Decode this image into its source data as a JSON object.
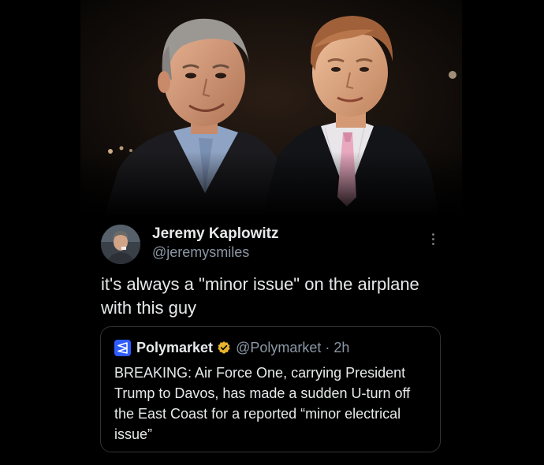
{
  "colors": {
    "background": "#000000",
    "text_primary": "#e7e9ea",
    "text_secondary": "#8b98a5",
    "card_border": "#2f3336",
    "polymarket_brand": "#2e5cff",
    "verified_gold": "#e8b32c"
  },
  "photo": {
    "icon": "photo-image"
  },
  "tweet": {
    "author": {
      "display_name": "Jeremy Kaplowitz",
      "handle": "@jeremysmiles",
      "avatar_icon": "user-avatar"
    },
    "more_icon": "more-options-icon",
    "text": "it's always a \"minor issue\" on the airplane with this guy"
  },
  "quoted_tweet": {
    "logo_icon": "polymarket-logo-icon",
    "display_name": "Polymarket",
    "verified_icon": "verified-gold-badge-icon",
    "handle": "@Polymarket",
    "separator": "·",
    "time": "2h",
    "text": "BREAKING: Air Force One, carrying President Trump to Davos, has made a sudden U-turn off the East Coast for a reported “minor electrical issue”"
  }
}
